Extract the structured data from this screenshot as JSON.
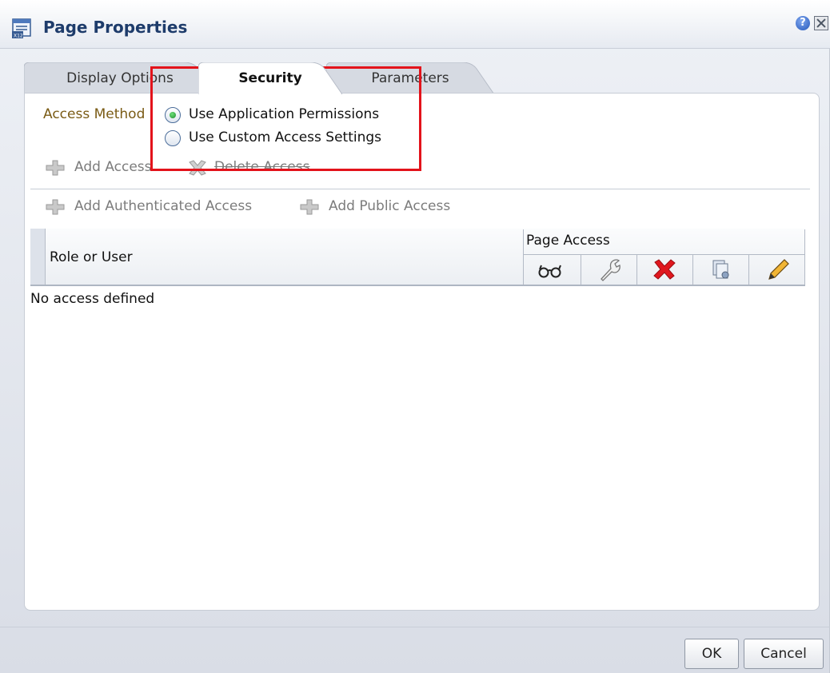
{
  "dialog": {
    "title": "Page Properties",
    "help_icon": "help-icon",
    "close_icon": "close-icon",
    "help_glyph": "?"
  },
  "tabs": [
    {
      "label": "Display Options",
      "active": false
    },
    {
      "label": "Security",
      "active": true
    },
    {
      "label": "Parameters",
      "active": false
    }
  ],
  "security": {
    "access_method_label": "Access Method",
    "options": [
      {
        "label": "Use Application Permissions",
        "selected": true
      },
      {
        "label": "Use Custom Access Settings",
        "selected": false
      }
    ],
    "toolbar1": {
      "add_access": "Add Access",
      "delete_access": "Delete Access"
    },
    "toolbar2": {
      "add_authenticated_access": "Add Authenticated Access",
      "add_public_access": "Add Public Access"
    },
    "grid": {
      "col_role": "Role or User",
      "col_page_access": "Page Access",
      "permission_icons": [
        "view-icon",
        "customize-icon",
        "delete-icon",
        "manage-icon",
        "edit-icon"
      ],
      "empty_message": "No access defined"
    }
  },
  "footer": {
    "ok_label": "OK",
    "cancel_label": "Cancel"
  },
  "colors": {
    "highlight_box": "#e3131b",
    "title_text": "#1e3c6b",
    "access_label": "#7a5b15"
  }
}
